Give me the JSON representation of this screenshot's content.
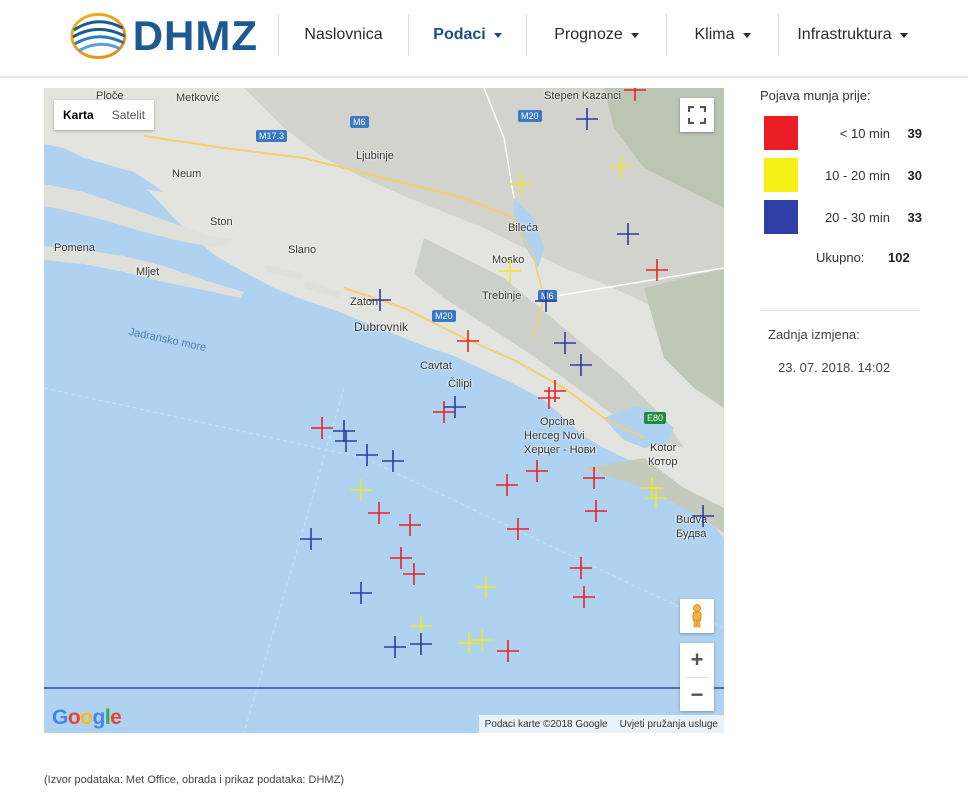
{
  "header": {
    "logo_text": "DHMZ",
    "nav": [
      {
        "label": "Naslovnica",
        "dropdown": false,
        "active": false
      },
      {
        "label": "Podaci",
        "dropdown": true,
        "active": true
      },
      {
        "label": "Prognoze",
        "dropdown": true,
        "active": false
      },
      {
        "label": "Klima",
        "dropdown": true,
        "active": false
      },
      {
        "label": "Infrastruktura",
        "dropdown": true,
        "active": false
      }
    ]
  },
  "map": {
    "map_type": {
      "map_label": "Karta",
      "satellite_label": "Satelit"
    },
    "zoom_in": "+",
    "zoom_out": "−",
    "google_logo": "Google",
    "attribution": {
      "data": "Podaci karte ©2018 Google",
      "terms": "Uvjeti pružanja usluge"
    },
    "sea_label": "Jadransko more",
    "place_labels": [
      "Ploče",
      "Metković",
      "Neum",
      "Ston",
      "Pomena",
      "Mljet",
      "Slano",
      "Ljubinje",
      "Bileća",
      "Mosko",
      "Trebinje",
      "Zaton",
      "Dubrovnik",
      "Cavtat",
      "Čilipi",
      "Opcina",
      "Herceg Novi",
      "Херцег - Нови",
      "Kotor",
      "Котор",
      "Budva",
      "Будва",
      "Stepen Kazanci"
    ],
    "road_labels": [
      "M17.3",
      "M6",
      "M20",
      "M20",
      "M6",
      "E80"
    ],
    "strike_colors": {
      "red": "#e8232a",
      "yellow": "#ece62b",
      "blue": "#2b3da0"
    }
  },
  "legend": {
    "title": "Pojava munja prije:",
    "items": [
      {
        "color": "#ea1d24",
        "range": "< 10 min",
        "count": "39"
      },
      {
        "color": "#f4ef16",
        "range": "10 - 20 min",
        "count": "30"
      },
      {
        "color": "#2f3fa6",
        "range": "20 - 30 min",
        "count": "33"
      }
    ],
    "total_label": "Ukupno:",
    "total_value": "102"
  },
  "last_update": {
    "label": "Zadnja izmjena:",
    "value": "23. 07. 2018. 14:02"
  },
  "source_note": "(Izvor podataka: Met Office, obrada i prikaz podataka: DHMZ)"
}
